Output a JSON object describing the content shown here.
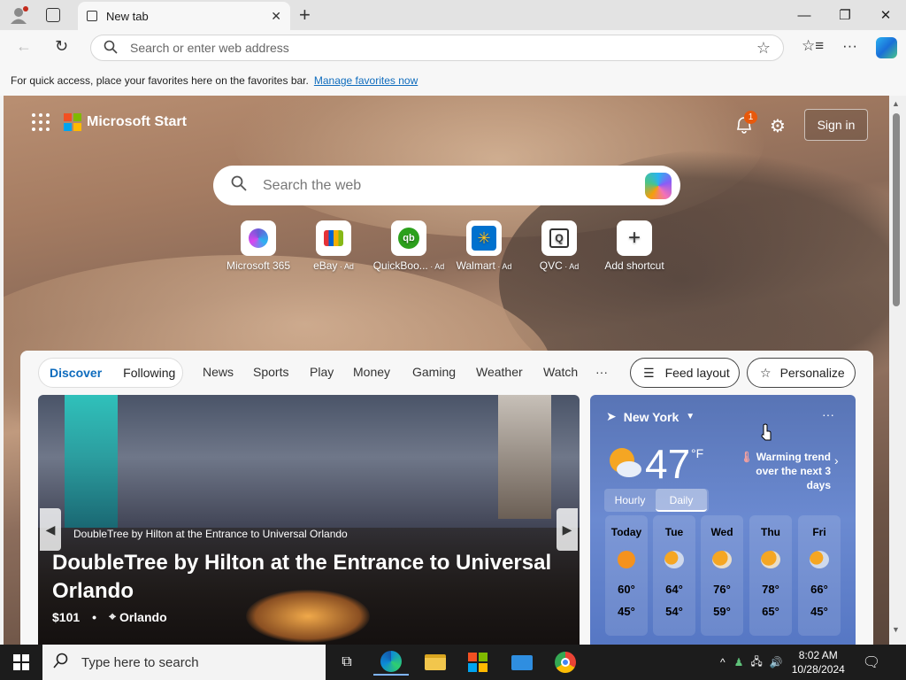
{
  "browser": {
    "tab_title": "New tab",
    "address_placeholder": "Search or enter web address",
    "favorites_hint": "For quick access, place your favorites here on the favorites bar.",
    "favorites_link": "Manage favorites now"
  },
  "start": {
    "brand": "Microsoft Start",
    "notification_count": "1",
    "signin_label": "Sign in",
    "search_placeholder": "Search the web",
    "shortcuts": [
      {
        "label": "Microsoft 365",
        "ad": ""
      },
      {
        "label": "eBay",
        "ad": " · Ad"
      },
      {
        "label": "QuickBoo...",
        "ad": " · Ad"
      },
      {
        "label": "Walmart",
        "ad": " · Ad"
      },
      {
        "label": "QVC",
        "ad": " · Ad"
      },
      {
        "label": "Add shortcut",
        "ad": ""
      }
    ]
  },
  "feed": {
    "tabs": [
      "Discover",
      "Following"
    ],
    "nav": [
      "News",
      "Sports",
      "Play",
      "Money",
      "Gaming",
      "Weather",
      "Watch",
      "···"
    ],
    "feed_layout_label": "Feed layout",
    "personalize_label": "Personalize"
  },
  "hero": {
    "source": "DoubleTree by Hilton at the Entrance to Universal Orlando",
    "title": "DoubleTree by Hilton at the Entrance to Universal Orlando",
    "price": "$101",
    "location": "Orlando"
  },
  "weather": {
    "city": "New York",
    "temp": "47",
    "unit": "°F",
    "trend_line1": "Warming trend",
    "trend_line2": "over the next 3 days",
    "tabs": [
      "Hourly",
      "Daily"
    ],
    "days": [
      {
        "name": "Today",
        "high": "60°",
        "low": "45°"
      },
      {
        "name": "Tue",
        "high": "64°",
        "low": "54°"
      },
      {
        "name": "Wed",
        "high": "76°",
        "low": "59°"
      },
      {
        "name": "Thu",
        "high": "78°",
        "low": "65°"
      },
      {
        "name": "Fri",
        "high": "66°",
        "low": "45°"
      }
    ]
  },
  "taskbar": {
    "search_placeholder": "Type here to search",
    "time": "8:02 AM",
    "date": "10/28/2024"
  },
  "colors": {
    "accent": "#0f6cbd",
    "weather_bg": "#5f7fc6",
    "taskbar": "#1c1c1c"
  }
}
